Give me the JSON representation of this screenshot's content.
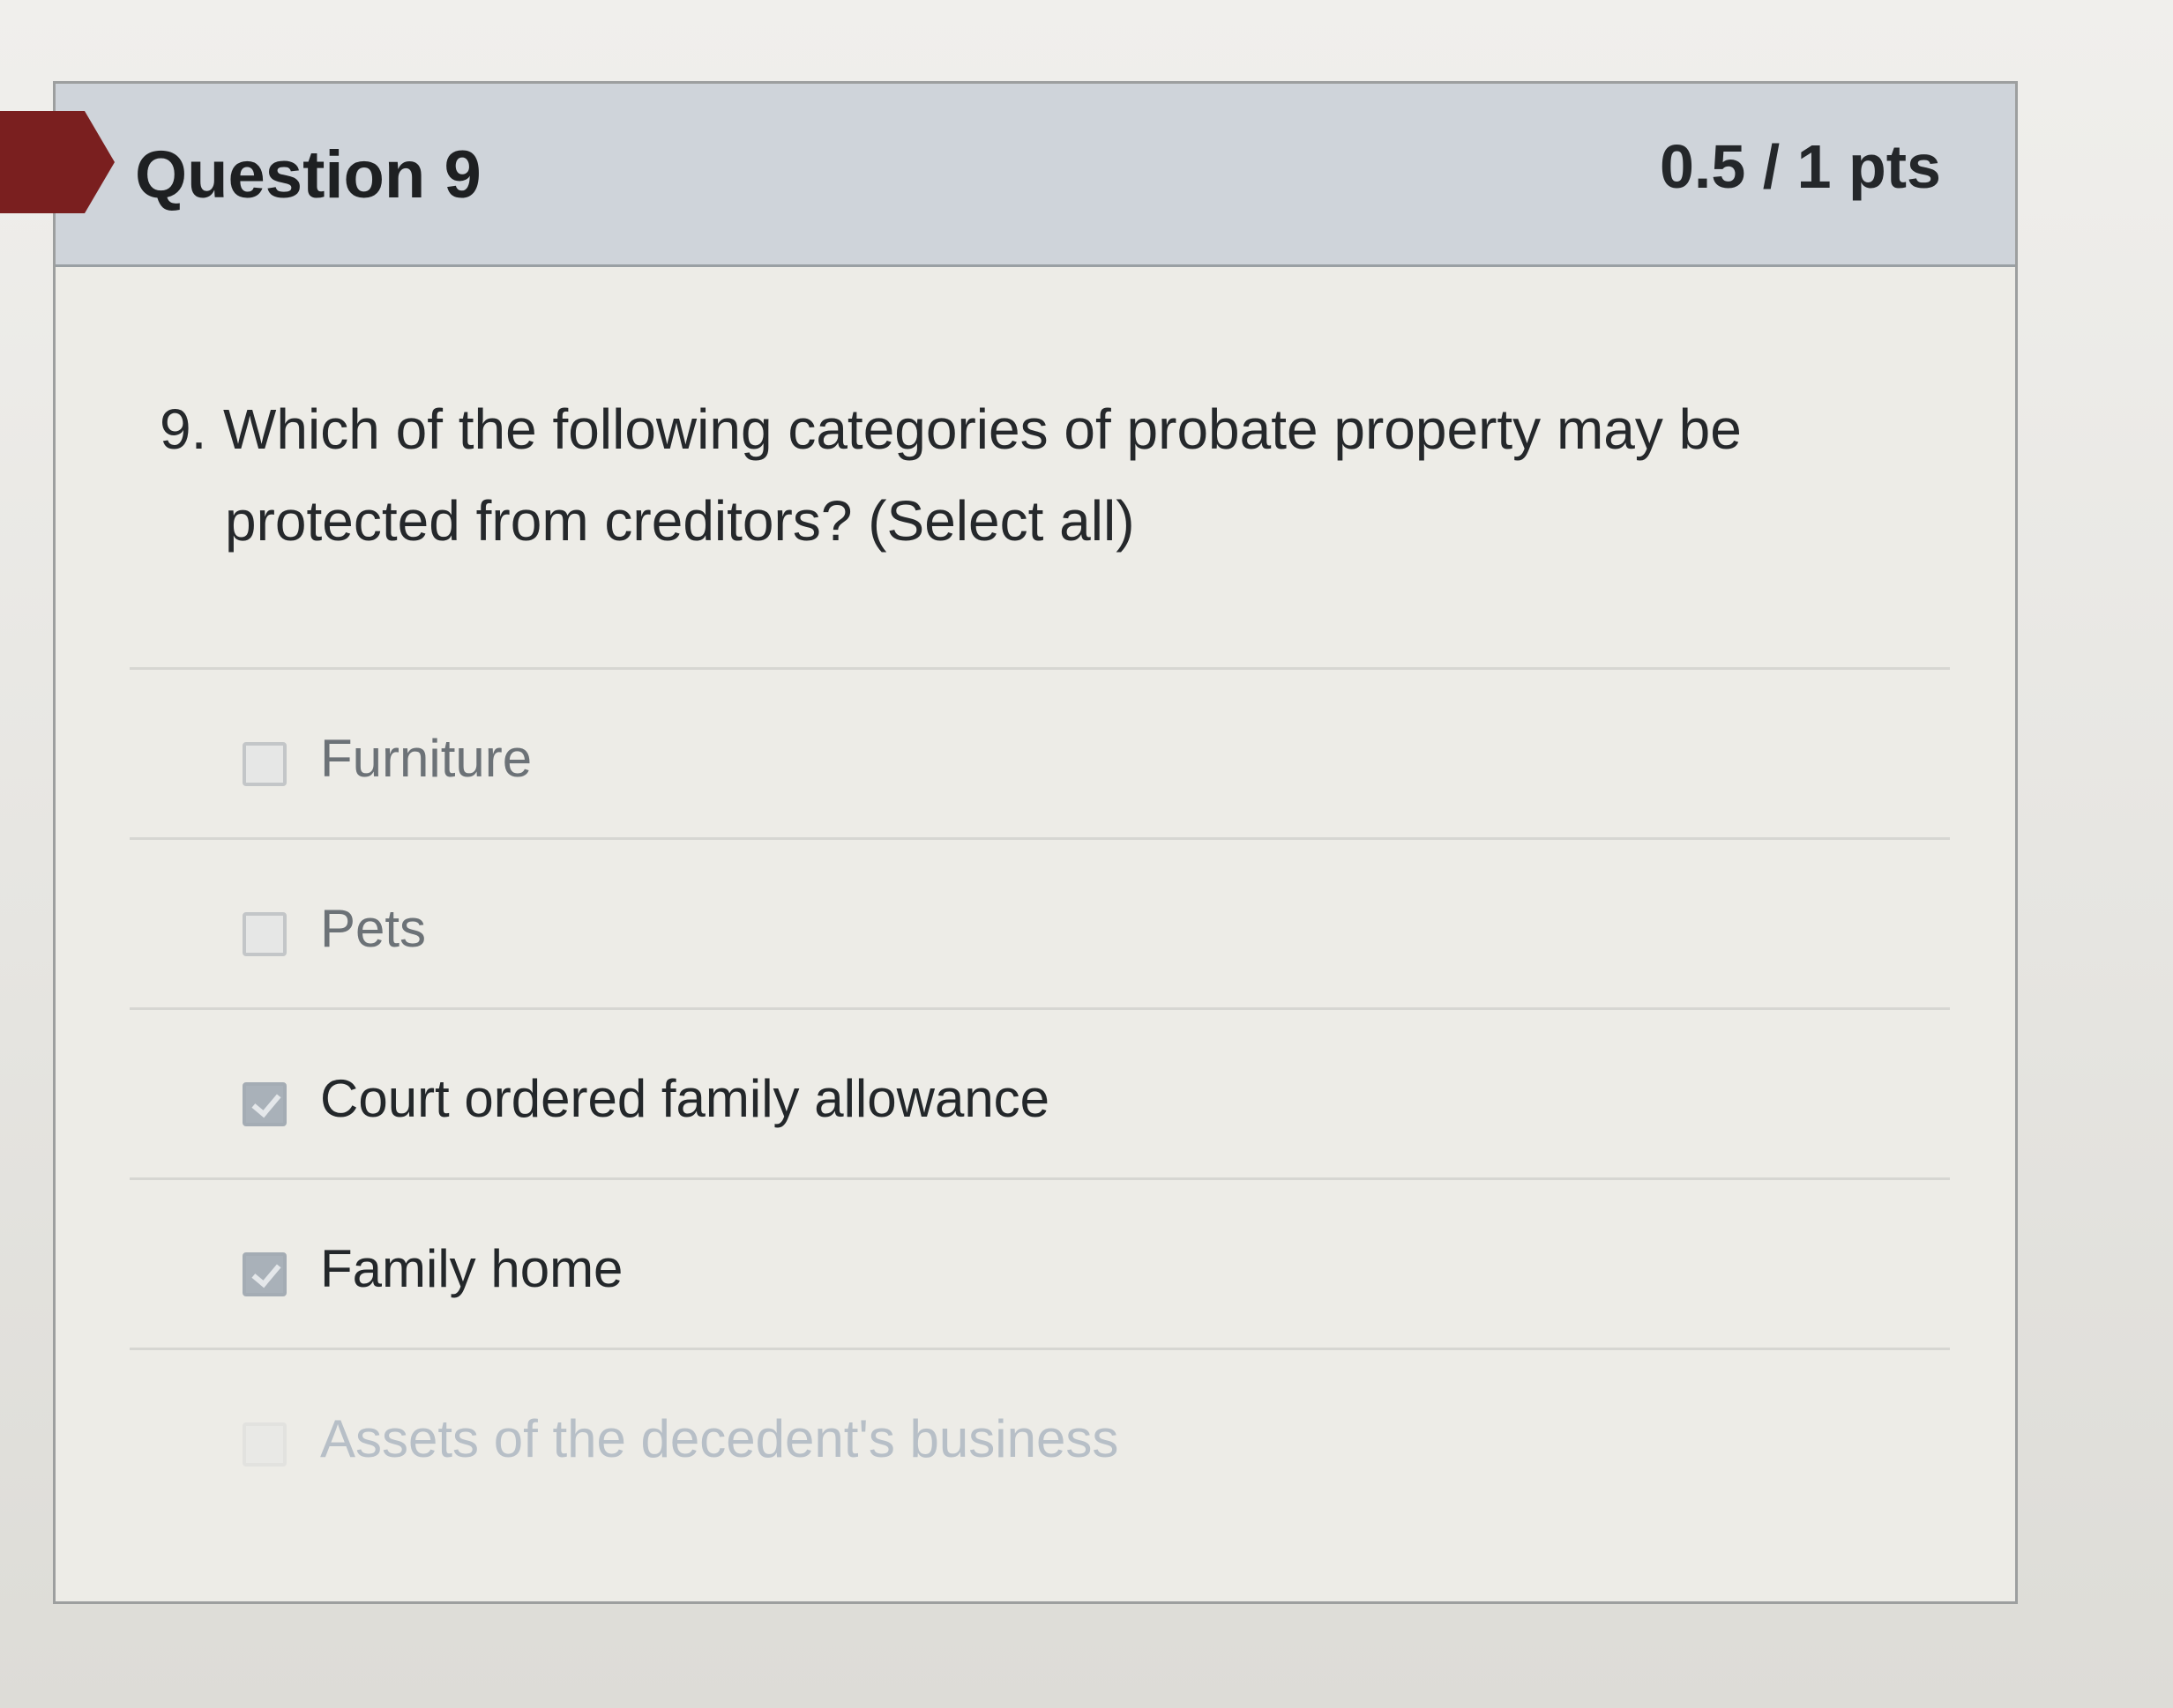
{
  "question": {
    "title": "Question 9",
    "points": "0.5 / 1 pts",
    "number": "9.",
    "text_line1": "Which of the following categories of probate property may be",
    "text_line2": "protected from creditors? (Select all)"
  },
  "answers": [
    {
      "label": "Furniture",
      "checked": false
    },
    {
      "label": "Pets",
      "checked": false
    },
    {
      "label": "Court ordered family allowance",
      "checked": true
    },
    {
      "label": "Family home",
      "checked": true
    },
    {
      "label": "Assets of the decedent's business",
      "checked": false
    }
  ],
  "colors": {
    "header_background": "#cfd4da",
    "flag_marker": "#7a1f1f",
    "selected_checkbox": "#a9b1b9"
  }
}
